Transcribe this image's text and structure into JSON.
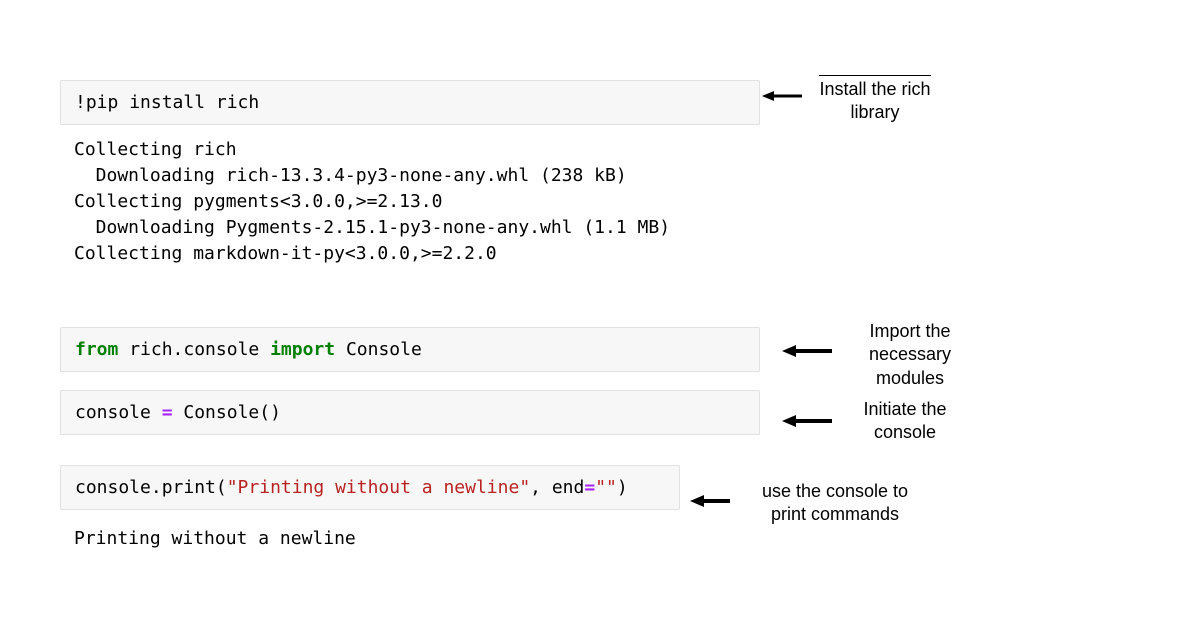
{
  "cells": {
    "c1": {
      "prefix": "!",
      "cmd": "pip install rich"
    },
    "out1_l1": "Collecting rich",
    "out1_l2": "  Downloading rich-13.3.4-py3-none-any.whl (238 kB)",
    "out1_l3": "Collecting pygments<3.0.0,>=2.13.0",
    "out1_l4": "  Downloading Pygments-2.15.1-py3-none-any.whl (1.1 MB)",
    "out1_l5": "Collecting markdown-it-py<3.0.0,>=2.2.0",
    "c2": {
      "kw_from": "from",
      "mod": " rich.console ",
      "kw_import": "import",
      "name": " Console"
    },
    "c3": {
      "lhs": "console ",
      "eq": "=",
      "rhs": " Console()"
    },
    "c4": {
      "call1": "console.print(",
      "str1": "\"Printing without a newline\"",
      "sep": ", end",
      "eq": "=",
      "str2": "\"\"",
      "close": ")"
    },
    "out4": "Printing without a newline"
  },
  "annotations": {
    "a1": "Install the rich\nlibrary",
    "a2": "Import the\nnecessary\nmodules",
    "a3": "Initiate the\nconsole",
    "a4": "use the console to\nprint commands"
  }
}
